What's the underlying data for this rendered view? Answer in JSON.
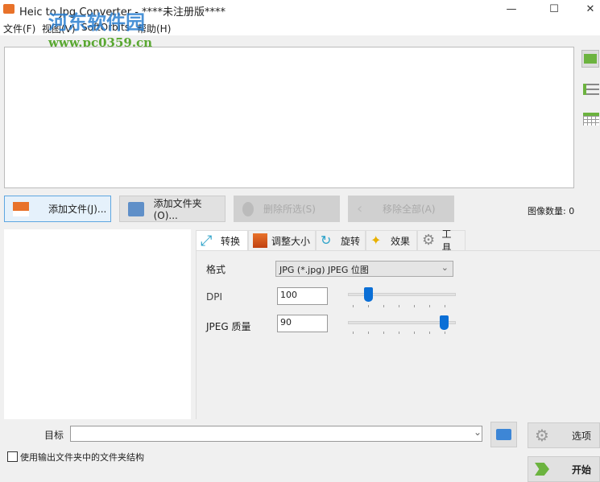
{
  "window": {
    "title": "Heic to Jpg Converter - ****未注册版****",
    "minimize": "—",
    "maximize": "☐",
    "close": "✕"
  },
  "menu": [
    "文件(F)",
    "视图(V)",
    "SoftOrbits",
    "帮助(H)"
  ],
  "watermark": {
    "name": "河东软件园",
    "url": "www.pc0359.cn"
  },
  "toolbar": {
    "add_file": "添加文件(J)...",
    "add_folder": "添加文件夹(O)...",
    "remove_selected": "删除所选(S)",
    "remove_all": "移除全部(A)",
    "image_count_label": "图像数量:",
    "image_count": "0"
  },
  "tabs": [
    "转换",
    "调整大小",
    "旋转",
    "效果",
    "工具"
  ],
  "convert": {
    "format_label": "格式",
    "format_value": "JPG (*.jpg) JPEG 位图",
    "dpi_label": "DPI",
    "dpi_value": "100",
    "dpi_slider_fraction": 0.15,
    "quality_label": "JPEG 质量",
    "quality_value": "90",
    "quality_slider_fraction": 0.9
  },
  "bottom": {
    "target_label": "目标",
    "target_value": "",
    "checkbox_label": "使用输出文件夹中的文件夹结构",
    "options": "选项",
    "start": "开始"
  },
  "colors": {
    "accent": "#0b6fd6",
    "green": "#6cb33f"
  }
}
